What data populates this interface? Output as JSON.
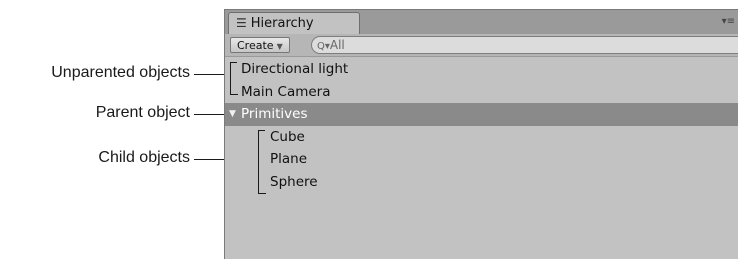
{
  "annotations": {
    "unparented": "Unparented objects",
    "parent": "Parent object",
    "child": "Child objects"
  },
  "window": {
    "tab_icon": "hierarchy-list-icon",
    "tab_label": "Hierarchy",
    "menu_icon": "panel-menu-icon"
  },
  "toolbar": {
    "create_label": "Create",
    "search_placeholder": "All"
  },
  "tree": {
    "items": [
      {
        "label": "Directional light",
        "depth": 0,
        "selected": false
      },
      {
        "label": "Main Camera",
        "depth": 0,
        "selected": false
      },
      {
        "label": "Primitives",
        "depth": 0,
        "selected": true,
        "expanded": true
      },
      {
        "label": "Cube",
        "depth": 1,
        "selected": false
      },
      {
        "label": "Plane",
        "depth": 1,
        "selected": false
      },
      {
        "label": "Sphere",
        "depth": 1,
        "selected": false
      }
    ]
  },
  "colors": {
    "panel_bg": "#c2c2c2",
    "selected_row": "#8a8a8a",
    "tab_strip": "#9a9a9a"
  }
}
